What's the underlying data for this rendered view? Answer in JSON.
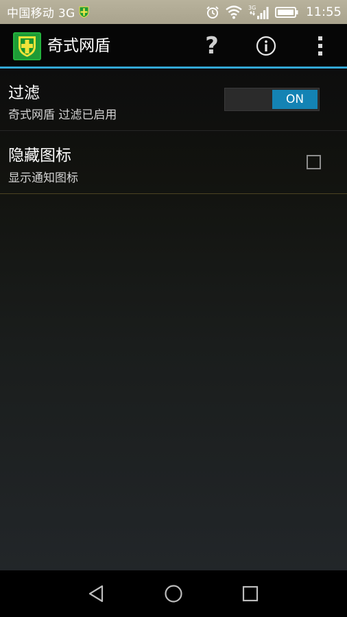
{
  "status_bar": {
    "carrier": "中国移动 3G",
    "time": "11:55",
    "icons": [
      "shield-app-icon",
      "alarm-icon",
      "wifi-icon",
      "3g-signal-icon",
      "battery-icon"
    ],
    "network_badge": "3G"
  },
  "action_bar": {
    "title": "奇式网盾",
    "help_label": "?",
    "icons": [
      "app-shield-icon",
      "help-icon",
      "info-icon",
      "overflow-menu-icon"
    ],
    "accent_color": "#33a8d6"
  },
  "preferences": [
    {
      "title": "过滤",
      "summary": "奇式网盾 过滤已启用",
      "control": "switch",
      "switch_label": "ON",
      "checked": true
    },
    {
      "title": "隐藏图标",
      "summary": "显示通知图标",
      "control": "checkbox",
      "checked": false
    }
  ],
  "nav_bar": {
    "icons": [
      "back-icon",
      "home-icon",
      "recents-icon"
    ]
  }
}
